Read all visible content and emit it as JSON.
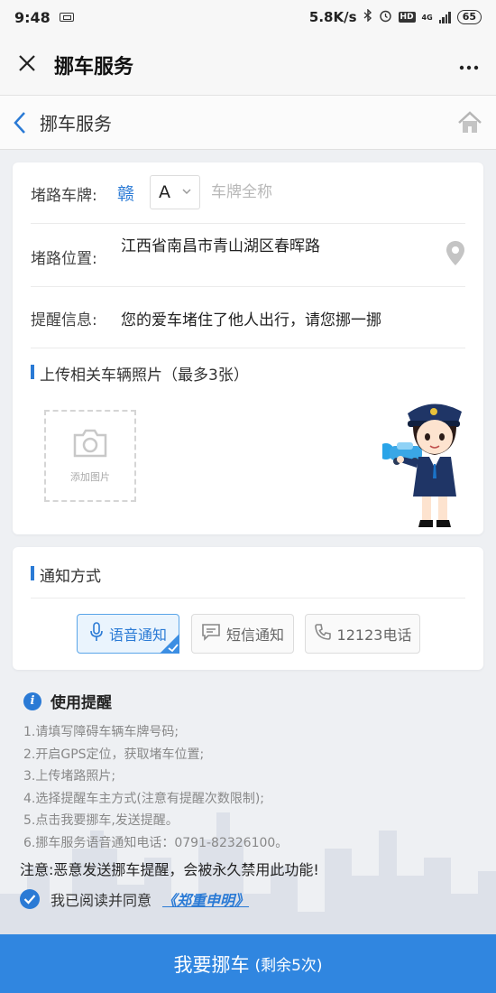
{
  "status_bar": {
    "time": "9:48",
    "speed": "5.8K/s",
    "network": "HD",
    "network_type": "4G",
    "battery": "65"
  },
  "app_bar": {
    "title": "挪车服务",
    "close_icon": "close-icon",
    "more_icon": "more-icon"
  },
  "nav": {
    "title": "挪车服务",
    "back_icon": "chevron-left-icon",
    "home_icon": "home-icon"
  },
  "form": {
    "plate_label": "堵路车牌:",
    "province": "赣",
    "letter": "A",
    "plate_placeholder": "车牌全称",
    "location_label": "堵路位置:",
    "location_value": "江西省南昌市青山湖区春晖路",
    "message_label": "提醒信息:",
    "message_value": "您的爱车堵住了他人出行，请您挪一挪",
    "upload_title": "上传相关车辆照片（最多3张）",
    "add_photo_label": "添加图片"
  },
  "notify": {
    "title": "通知方式",
    "options": [
      {
        "label": "语音通知",
        "icon": "microphone-icon",
        "selected": true
      },
      {
        "label": "短信通知",
        "icon": "message-icon",
        "selected": false
      },
      {
        "label": "12123电话",
        "icon": "phone-icon",
        "selected": false
      }
    ]
  },
  "tips": {
    "title": "使用提醒",
    "items": [
      "1.请填写障碍车辆车牌号码;",
      "2.开启GPS定位，获取堵车位置;",
      "3.上传堵路照片;",
      "4.选择提醒车主方式(注意有提醒次数限制);",
      "5.点击我要挪车,发送提醒。",
      "6.挪车服务语音通知电话：0791-82326100。"
    ]
  },
  "warning": "注意:恶意发送挪车提醒，会被永久禁用此功能!",
  "agree": {
    "text": "我已阅读并同意",
    "link": "《郑重申明》",
    "checked": true
  },
  "submit": {
    "label": "我要挪车",
    "remaining": "(剩余5次)"
  },
  "colors": {
    "accent": "#3086e0",
    "link": "#2a7ad5",
    "background": "#eef0f3"
  }
}
